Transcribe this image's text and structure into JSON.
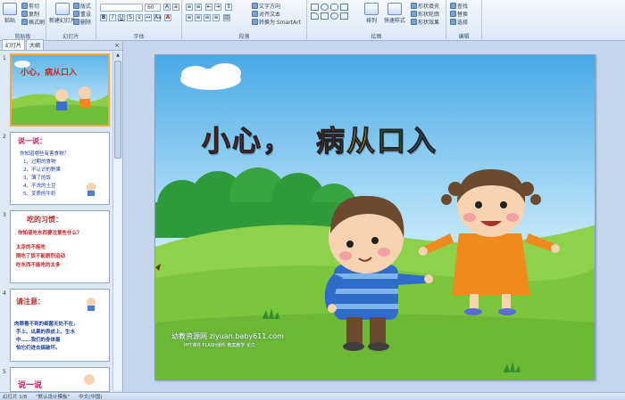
{
  "ribbon": {
    "clipboard": {
      "label": "剪贴板",
      "paste": "粘贴",
      "cut": "剪切",
      "copy": "复制",
      "format_painter": "格式刷"
    },
    "slides": {
      "label": "幻灯片",
      "new_slide": "新建幻灯片",
      "layout": "版式",
      "reset": "重设",
      "delete": "删除"
    },
    "font": {
      "label": "字体",
      "font_name": "",
      "font_size": "60"
    },
    "paragraph": {
      "label": "段落",
      "text_direction": "文字方向",
      "align_text": "对齐文本",
      "smartart": "转换为 SmartArt"
    },
    "drawing": {
      "label": "绘图",
      "arrange": "排列",
      "quick_styles": "快速样式",
      "shape_fill": "形状填充",
      "shape_outline": "形状轮廓",
      "shape_effects": "形状效果"
    },
    "editing": {
      "label": "编辑",
      "find": "查找",
      "replace": "替换",
      "select": "选择"
    }
  },
  "left_pane": {
    "tab_slides": "幻灯片",
    "tab_outline": "大纲",
    "close": "×",
    "thumbnails": [
      {
        "number": "1",
        "title": "小心，病从口入"
      },
      {
        "number": "2",
        "title": "说一说：",
        "lines": [
          "你知道哪些有害食物？",
          "1、过期的食物",
          "2、不认识的野果",
          "3、薄了的饭",
          "4、不洗的土豆",
          "5、变质的牛奶"
        ]
      },
      {
        "number": "3",
        "title": "吃的习惯：",
        "lines": [
          "你知道吃东西要注意些什么？",
          "太凉的不能吃",
          "刚吃了饭不能剧烈运动",
          "吃东西不能吃的太多"
        ]
      },
      {
        "number": "4",
        "title": "请注意：",
        "lines": [
          "肉眼看不到的细菌无处不在，",
          "手上、瓜果的表皮上、生水",
          "中……我们的身体最",
          "怕它们进去搞破坏。"
        ]
      },
      {
        "number": "5",
        "title": "说一说"
      }
    ]
  },
  "slide": {
    "title_chars": [
      "小",
      "心",
      "，",
      "病",
      "从",
      "口",
      "入"
    ],
    "title_colors": [
      "#d8231f",
      "#e0227a",
      "#7c3fbf",
      "#e84e2a",
      "#f4a21e",
      "#2f9c3e",
      "#2a7fd4"
    ],
    "watermark_line1": "幼教资源网 ziyuan.baby611.com",
    "watermark_line2": "PPT课件 FLASH课件 教案教学 论文"
  },
  "status": {
    "slide_info": "幻灯片 1/8",
    "theme": "\"默认设计模板\"",
    "language": "中文(中国)"
  }
}
